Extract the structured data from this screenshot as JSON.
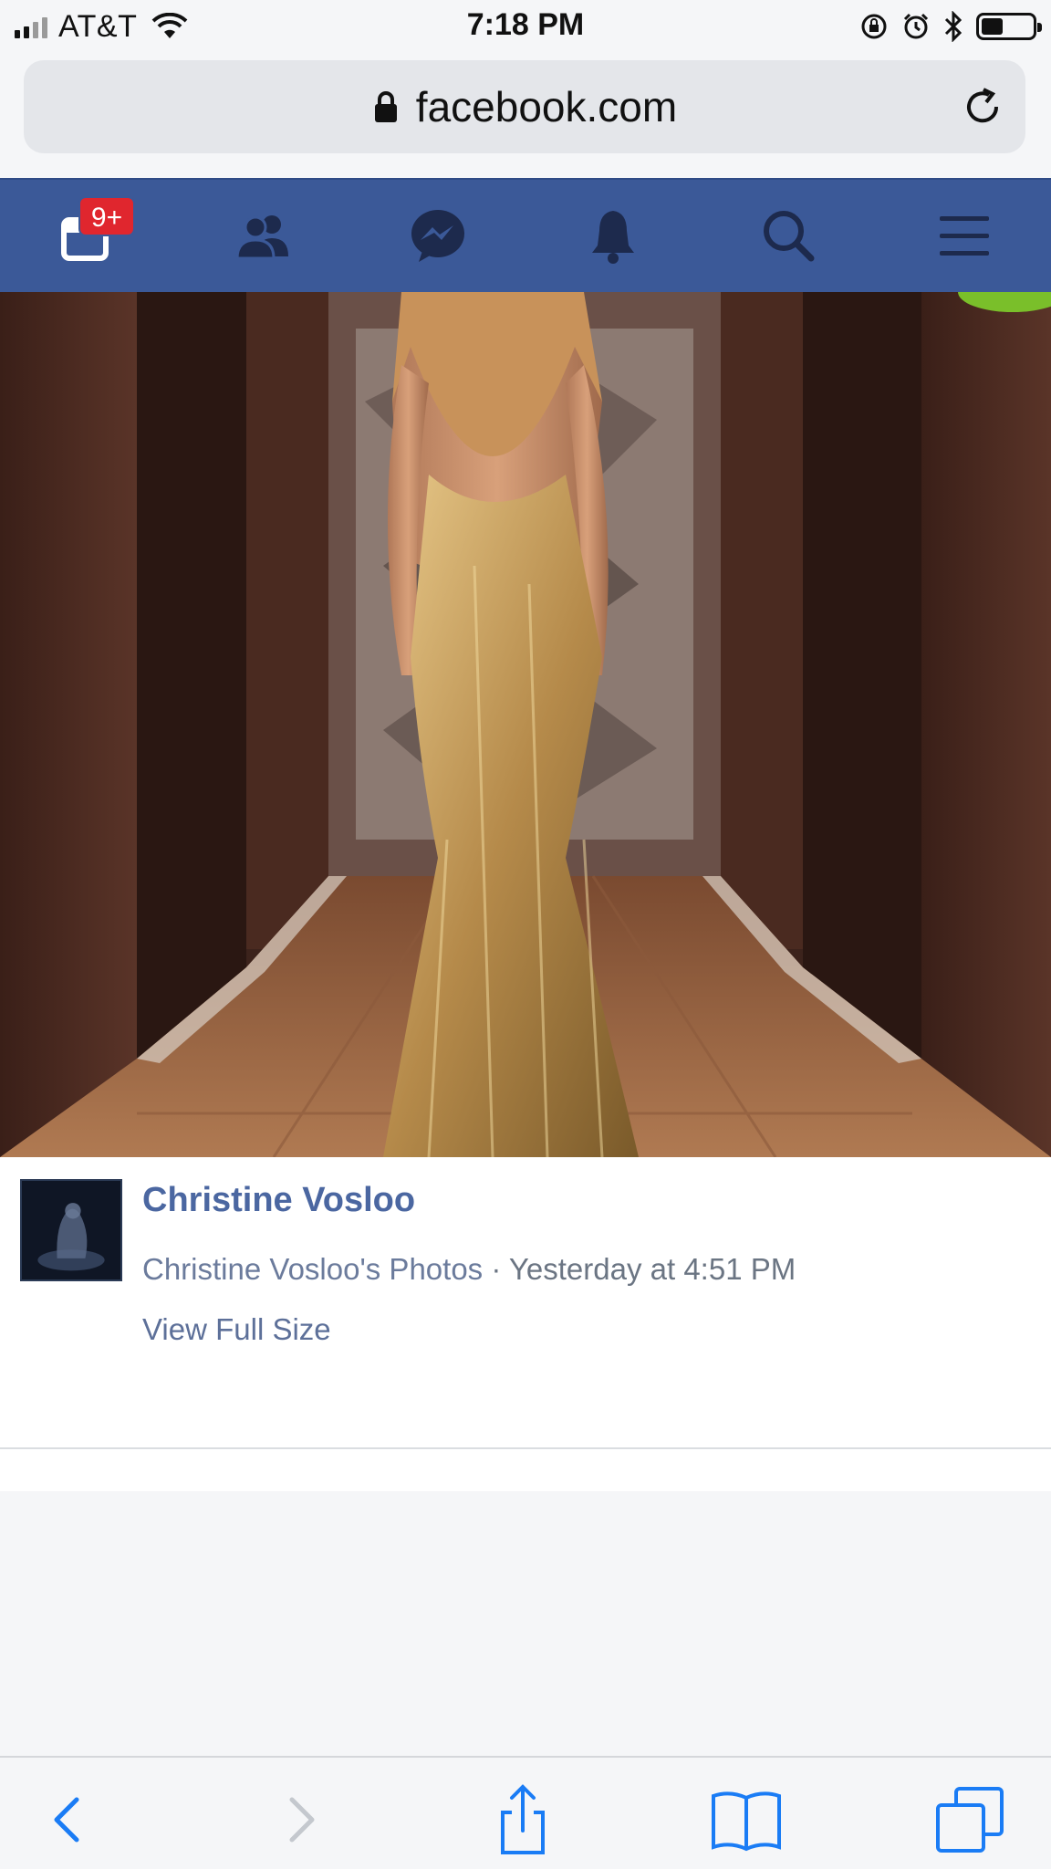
{
  "status_bar": {
    "carrier": "AT&T",
    "time": "7:18 PM",
    "battery_level": 0.42
  },
  "browser": {
    "url": "facebook.com"
  },
  "fb_nav": {
    "notifications_badge": "9+",
    "items": [
      "home-feed-icon",
      "friends-icon",
      "messenger-icon",
      "bell-icon",
      "search-icon",
      "menu-icon"
    ]
  },
  "post": {
    "author": "Christine Vosloo",
    "album": "Christine Vosloo's Photos",
    "separator": " · ",
    "timestamp": "Yesterday at 4:51 PM",
    "view_full_size": "View Full Size"
  },
  "toolbar": {
    "items": [
      "back-icon",
      "forward-icon",
      "share-icon",
      "bookmarks-icon",
      "tabs-icon"
    ]
  },
  "colors": {
    "fb_blue": "#3b5998",
    "badge_red": "#e0262e",
    "link_blue": "#4b67a1",
    "ios_blue": "#1a7cf5"
  }
}
